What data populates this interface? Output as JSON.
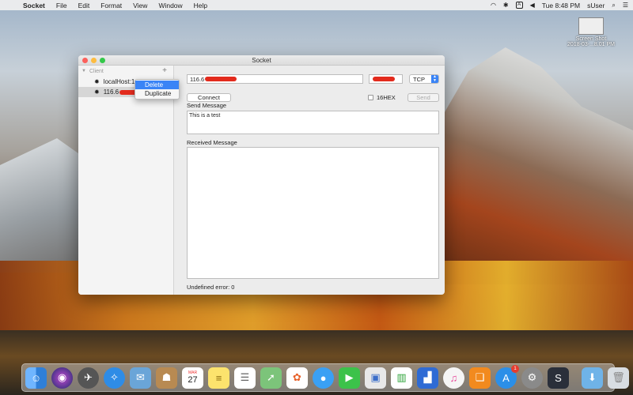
{
  "menubar": {
    "app_name": "Socket",
    "items": [
      "File",
      "Edit",
      "Format",
      "View",
      "Window",
      "Help"
    ],
    "clock": "Tue 8:48 PM",
    "user": "sUser",
    "input_source": "A"
  },
  "desktop": {
    "file_name": "Screen Shot",
    "file_date": "2018-03-...8.01 PM"
  },
  "window": {
    "title": "Socket",
    "sidebar": {
      "section": "Client",
      "items": [
        {
          "label": "localHost:1"
        },
        {
          "label": "116.6"
        }
      ]
    },
    "context_menu": {
      "items": [
        {
          "label": "Delete"
        },
        {
          "label": "Duplicate"
        }
      ]
    },
    "main": {
      "host_value": "116.6",
      "protocol": "TCP",
      "connect_label": "Connect",
      "hex_label": "16HEX",
      "send_label": "Send",
      "send_message_label": "Send Message",
      "send_message_value": "This is a test",
      "received_message_label": "Received Message",
      "received_message_value": "",
      "status": "Undefined error: 0"
    }
  },
  "dock": {
    "apps": [
      "finder",
      "siri",
      "launchpad",
      "safari",
      "mail",
      "contacts",
      "calendar",
      "notes",
      "reminders",
      "maps",
      "photos",
      "messages",
      "facetime",
      "preview",
      "numbers",
      "keynote",
      "itunes",
      "ibooks",
      "app-store",
      "system-preferences",
      "socket",
      "downloads",
      "trash"
    ],
    "calendar_day": "27",
    "calendar_month": "MAR",
    "app_store_badge": "1"
  }
}
